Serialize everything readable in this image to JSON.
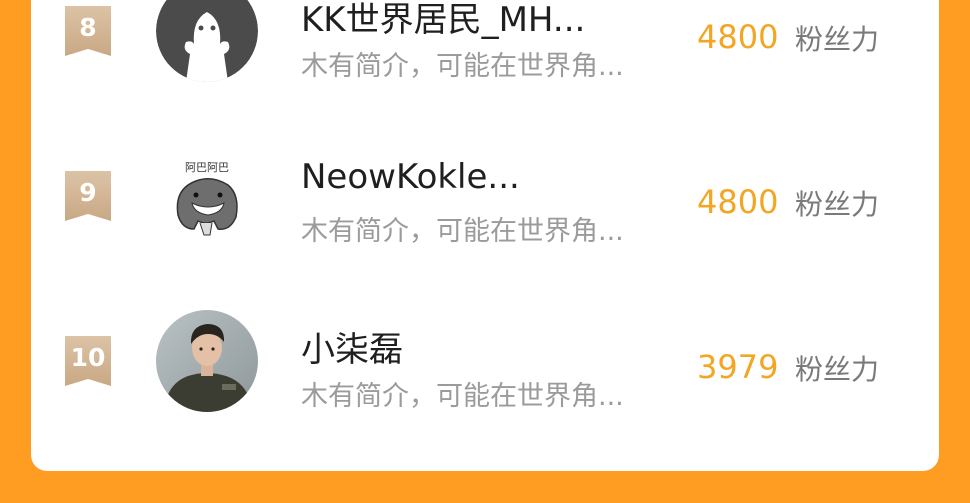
{
  "leaderboard": {
    "rows": [
      {
        "rank": "8",
        "name": "KK世界居民_MH...",
        "bio": "木有简介，可能在世界角...",
        "score": "4800",
        "unit": "粉丝力",
        "avatar_icon": "default-person-avatar-icon"
      },
      {
        "rank": "9",
        "name": "NeowKokle...",
        "bio": "木有简介，可能在世界角...",
        "score": "4800",
        "unit": "粉丝力",
        "avatar_icon": "cartoon-shark-avatar-icon",
        "avatar_caption": "阿巴阿巴"
      },
      {
        "rank": "10",
        "name": "小柒磊",
        "bio": "木有简介，可能在世界角...",
        "score": "3979",
        "unit": "粉丝力",
        "avatar_icon": "photo-avatar-icon"
      }
    ]
  },
  "colors": {
    "background": "#ff9c22",
    "score": "#f2a623",
    "rank_badge": "#d4b693"
  }
}
